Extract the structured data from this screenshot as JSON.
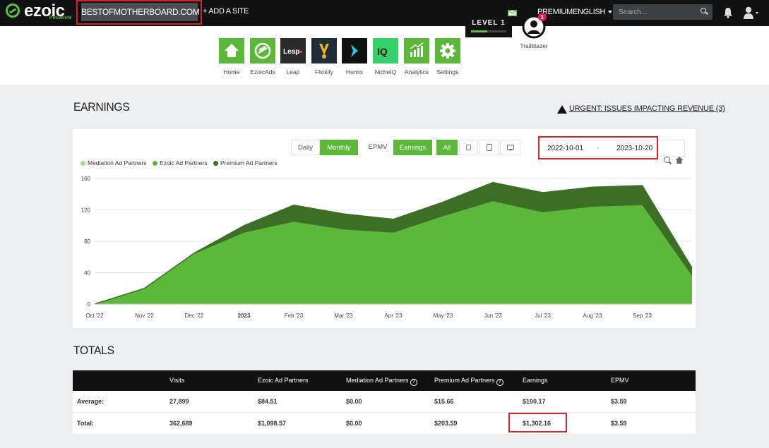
{
  "header": {
    "logo_text": "ezoic",
    "logo_sub": "PREMIUM",
    "site": "BESTOFMOTHERBOARD.COM",
    "add_site": "+ ADD A SITE",
    "premium": "PREMIUM",
    "language": "ENGLISH",
    "search_placeholder": "Search..."
  },
  "apps": [
    {
      "label": "Home",
      "color": "#5cb83a",
      "icon": "home-icon"
    },
    {
      "label": "EzoicAds",
      "color": "#5cb83a",
      "icon": "ezoicads-icon"
    },
    {
      "label": "Leap",
      "color": "#2b2b2b",
      "icon": "leap-icon"
    },
    {
      "label": "Flickify",
      "color": "#1f2e38",
      "icon": "flickify-icon"
    },
    {
      "label": "Humix",
      "color": "#111111",
      "icon": "humix-icon"
    },
    {
      "label": "NicheIQ",
      "color": "#35d16a",
      "icon": "nicheiq-icon"
    },
    {
      "label": "Analytics",
      "color": "#5cb83a",
      "icon": "analytics-icon"
    },
    {
      "label": "Settings",
      "color": "#5cb83a",
      "icon": "gear-icon"
    }
  ],
  "level": {
    "label": "LEVEL 1",
    "progress": 0.45
  },
  "trailblazer": {
    "label": "Trailblazer",
    "badge": "1"
  },
  "earnings": {
    "title": "EARNINGS",
    "urgent": "URGENT: ISSUES IMPACTING REVENUE (3)",
    "controls": {
      "daily": "Daily",
      "monthly": "Monthly",
      "epmv": "EPMV",
      "earnings": "Earnings",
      "all": "All"
    },
    "date_from": "2022-10-01",
    "date_sep": "-",
    "date_to": "2023-10-20"
  },
  "chart_data": {
    "type": "area",
    "stacked": true,
    "x": [
      "Oct '22",
      "Nov '22",
      "Dec '22",
      "2023",
      "Feb '23",
      "Mar '23",
      "Apr '23",
      "May '23",
      "Jun '23",
      "Jul '23",
      "Aug '23",
      "Sep '23",
      ""
    ],
    "x_tick_labels": [
      "Oct '22",
      "Nov '22",
      "Dec '22",
      "2023",
      "Feb '23",
      "Mar '23",
      "Apr '23",
      "May '23",
      "Jun '23",
      "Jul '23",
      "Aug '23",
      "Sep '23"
    ],
    "ylim": [
      0,
      160
    ],
    "yticks": [
      0,
      40,
      80,
      120,
      160
    ],
    "grid": true,
    "legend_position": "top-left",
    "series": [
      {
        "name": "Mediation Ad Partners",
        "color": "#a6d98b",
        "values": [
          0,
          0,
          0,
          0,
          0,
          0,
          0,
          0,
          0,
          0,
          0,
          0,
          0
        ]
      },
      {
        "name": "Ezoic Ad Partners",
        "color": "#5cb83a",
        "values": [
          0,
          20,
          64,
          91,
          105,
          95,
          91,
          112,
          131,
          117,
          124,
          126,
          36
        ]
      },
      {
        "name": "Premium Ad Partners",
        "color": "#3d6e26",
        "values": [
          0,
          0,
          1,
          9,
          21,
          20,
          17,
          18,
          24,
          25,
          25,
          25,
          10
        ]
      }
    ]
  },
  "totals": {
    "title": "TOTALS",
    "columns": [
      "Visits",
      "Ezoic Ad Partners",
      "Mediation Ad Partners",
      "Premium Ad Partners",
      "Earnings",
      "EPMV"
    ],
    "rows": [
      {
        "label": "Average:",
        "cells": [
          "27,899",
          "$84.51",
          "$0.00",
          "$15.66",
          "$100.17",
          "$3.59"
        ]
      },
      {
        "label": "Total:",
        "cells": [
          "362,689",
          "$1,098.57",
          "$0.00",
          "$203.59",
          "$1,302.16",
          "$3.59"
        ]
      }
    ]
  }
}
